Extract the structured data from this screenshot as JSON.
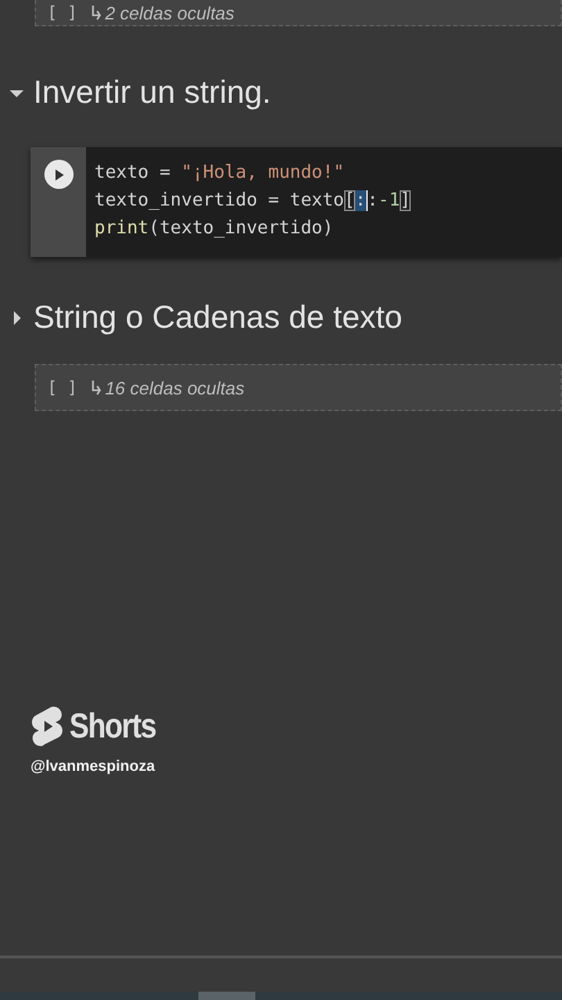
{
  "sections": [
    {
      "kind": "hidden",
      "brackets": "[ ]",
      "label": "2 celdas ocultas"
    },
    {
      "kind": "heading",
      "title": "Invertir un string.",
      "expanded": true
    },
    {
      "kind": "code",
      "lines": [
        [
          {
            "kind": "plain",
            "text": "texto = "
          },
          {
            "kind": "string",
            "text": "\"¡Hola, mundo!\""
          }
        ],
        [
          {
            "kind": "plain",
            "text": "texto_invertido = texto"
          },
          {
            "kind": "bracket",
            "text": "["
          },
          {
            "kind": "selected",
            "text": ":"
          },
          {
            "kind": "cursor",
            "text": ":"
          },
          {
            "kind": "number",
            "text": "-1"
          },
          {
            "kind": "bracket",
            "text": "]"
          }
        ],
        [
          {
            "kind": "func",
            "text": "print"
          },
          {
            "kind": "plain",
            "text": "(texto_invertido)"
          }
        ]
      ]
    },
    {
      "kind": "heading",
      "title": "String o Cadenas de texto",
      "expanded": false
    },
    {
      "kind": "hidden",
      "brackets": "[ ]",
      "label": "16 celdas ocultas"
    }
  ],
  "overlay": {
    "logo": "Shorts",
    "handle": "@lvanmespinoza"
  }
}
